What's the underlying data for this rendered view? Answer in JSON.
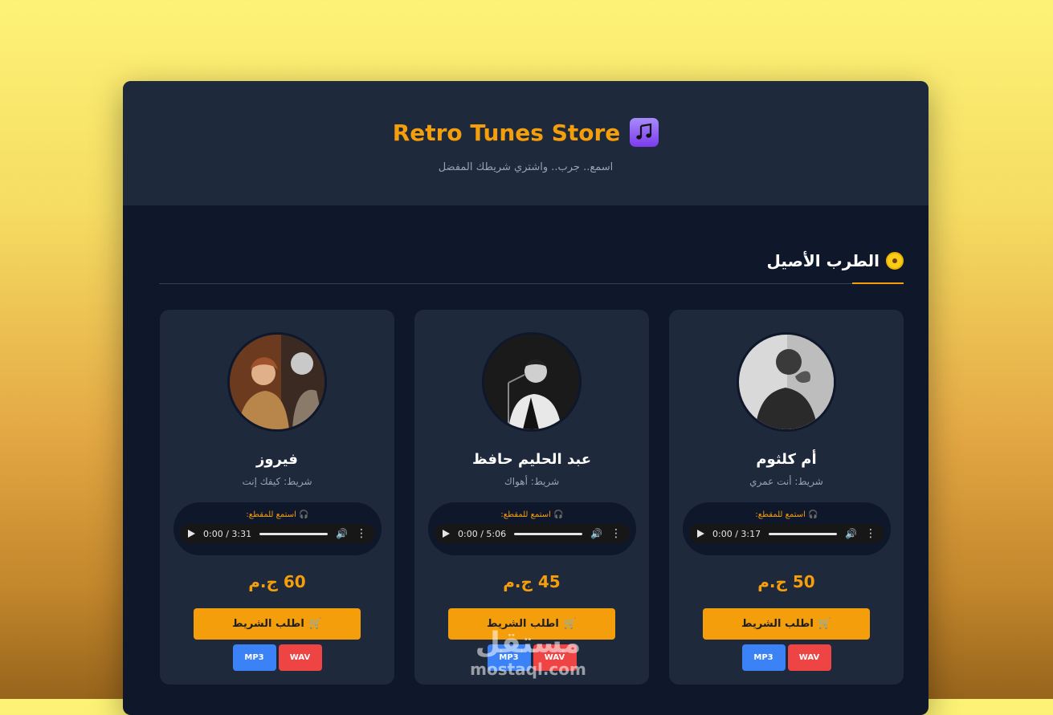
{
  "header": {
    "title": "Retro Tunes Store",
    "title_icon": "music-note-icon",
    "tagline": "اسمع.. جرب.. واشتري شريطك المفضل"
  },
  "section": {
    "title": "الطرب الأصيل",
    "icon": "vinyl-disc-icon"
  },
  "cards": [
    {
      "artist": "أم كلثوم",
      "album": "شريط: أنت عمري",
      "listen_label": "استمع للمقطع:",
      "time": "0:00 / 3:17",
      "price": "50 ج.م",
      "order_label": "اطلب الشريط",
      "mp3_label": "MP3",
      "wav_label": "WAV"
    },
    {
      "artist": "عبد الحليم حافظ",
      "album": "شريط: أهواك",
      "listen_label": "استمع للمقطع:",
      "time": "0:00 / 5:06",
      "price": "45 ج.م",
      "order_label": "اطلب الشريط",
      "mp3_label": "MP3",
      "wav_label": "WAV"
    },
    {
      "artist": "فيروز",
      "album": "شريط: كيفك إنت",
      "listen_label": "استمع للمقطع:",
      "time": "0:00 / 3:31",
      "price": "60 ج.م",
      "order_label": "اطلب الشريط",
      "mp3_label": "MP3",
      "wav_label": "WAV"
    }
  ],
  "watermark": {
    "arabic": "مستقل",
    "latin": "mostaql.com"
  },
  "colors": {
    "accent": "#f59e0b",
    "panel": "#1e293b",
    "background": "#0f172a",
    "mp3": "#3b82f6",
    "wav": "#ef4444"
  }
}
